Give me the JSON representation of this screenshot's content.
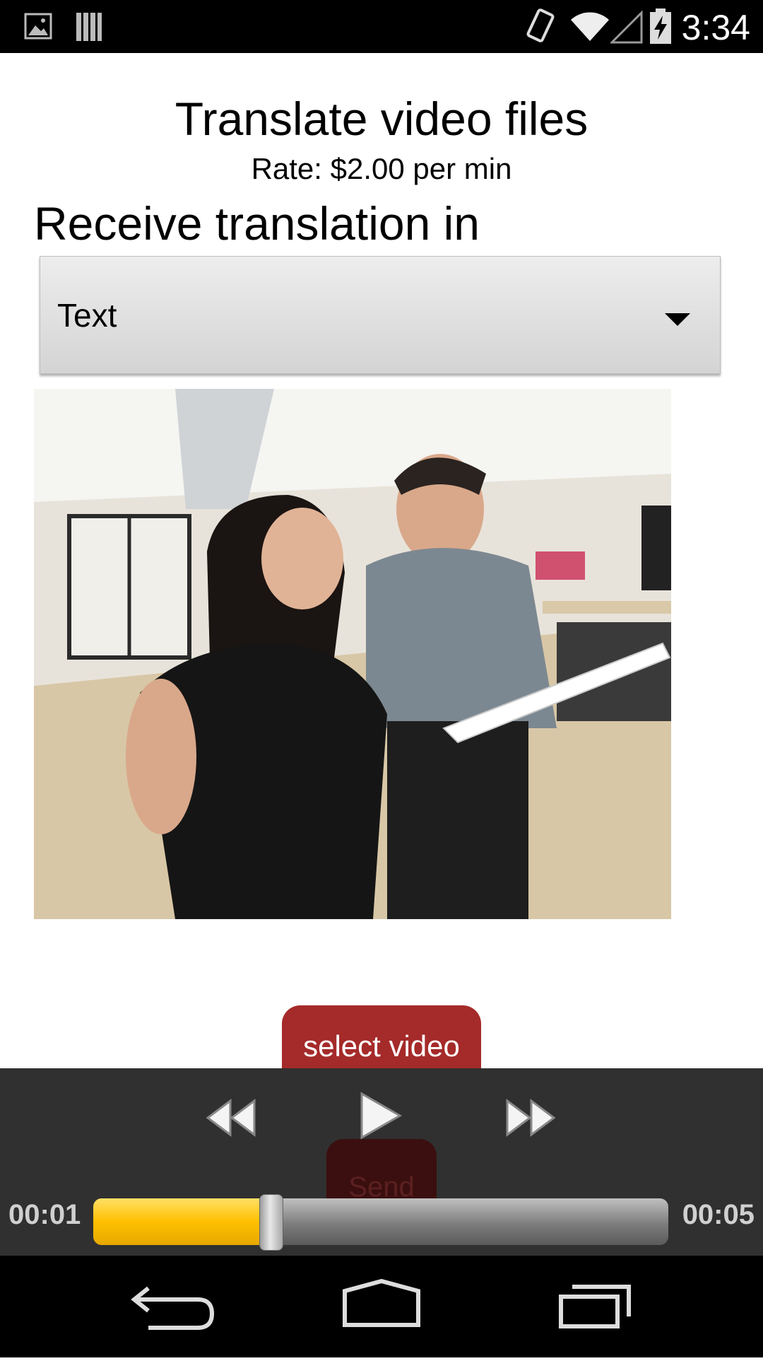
{
  "status_bar": {
    "time": "3:34"
  },
  "header": {
    "title": "Translate video files",
    "rate": "Rate: $2.00 per min",
    "receive_label": "Receive translation in"
  },
  "format_select": {
    "selected": "Text"
  },
  "buttons": {
    "select_video": "select video",
    "send": "Send"
  },
  "player": {
    "current_time": "00:01",
    "total_time": "00:05",
    "progress": 0.31
  },
  "colors": {
    "accent_button": "#a52a2a",
    "progress_fill": "#ffc000",
    "player_bg": "#303030"
  }
}
